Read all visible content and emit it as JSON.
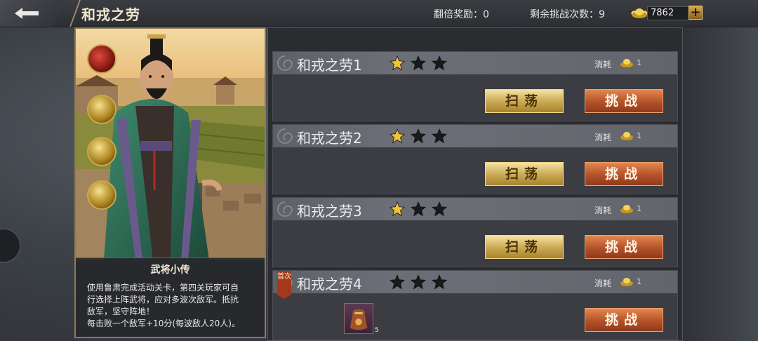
{
  "header": {
    "title": "和戎之劳",
    "double_reward": "翻倍奖励：0",
    "remaining": "剩余挑战次数：9",
    "gold": "7862",
    "plus": "+"
  },
  "hero": {
    "bio_title": "武将小传",
    "bio_lines": [
      "使用鲁肃完成活动关卡，第四关玩家可自",
      "行选择上阵武将，应对多波次敌军。抵抗",
      "敌军，坚守阵地！",
      "每击败一个敌军+10分(每波敌人20人)。"
    ]
  },
  "levels": [
    {
      "name": "和戎之劳1",
      "stars_earned": 1,
      "cost_label": "消耗",
      "cost": "1",
      "sweep": "扫荡",
      "challenge": "挑战"
    },
    {
      "name": "和戎之劳2",
      "stars_earned": 1,
      "cost_label": "消耗",
      "cost": "1",
      "sweep": "扫荡",
      "challenge": "挑战"
    },
    {
      "name": "和戎之劳3",
      "stars_earned": 1,
      "cost_label": "消耗",
      "cost": "1",
      "sweep": "扫荡",
      "challenge": "挑战"
    },
    {
      "name": "和戎之劳4",
      "stars_earned": 0,
      "cost_label": "消耗",
      "cost": "1",
      "first_badge": "首次",
      "reward_count": "5",
      "challenge": "挑战"
    }
  ],
  "colors": {
    "star_gold": "#f2c23a",
    "star_empty": "#1a1a1a",
    "challenge_orange": "#b4512a",
    "sweep_gold": "#c9a650"
  }
}
